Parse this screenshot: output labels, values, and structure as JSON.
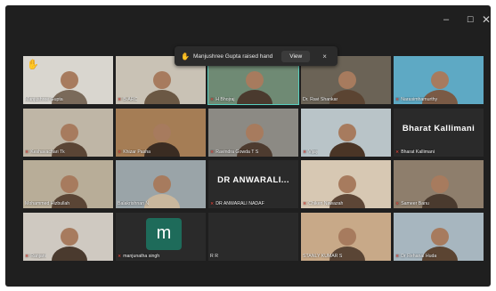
{
  "window": {
    "controls": {
      "minimize": "–",
      "maximize": "☐",
      "close": "✕"
    }
  },
  "notification": {
    "icon": "raised-hand-icon",
    "text": "Manjushree Gupta raised hand",
    "view_label": "View",
    "close_symbol": "×"
  },
  "tiles": [
    {
      "name": "Manjushree Gupta",
      "muted": false,
      "hand_raised": true
    },
    {
      "name": "B-ARC",
      "muted": true
    },
    {
      "name": "H Bhojraj",
      "muted": true,
      "active": true
    },
    {
      "name": "Dr. Ravi Shankar",
      "muted": false
    },
    {
      "name": "Narasimhamurthy",
      "muted": true
    },
    {
      "name": "Keshavachari Tk",
      "muted": true
    },
    {
      "name": "Khizar Pasha",
      "muted": true
    },
    {
      "name": "Ravindra Gowda T S",
      "muted": true
    },
    {
      "name": "Vijay",
      "muted": true
    },
    {
      "name": "Bharat Kallimani",
      "muted": true,
      "big_label": "Bharat Kallimani"
    },
    {
      "name": "Mohammed Hizbullah",
      "muted": false
    },
    {
      "name": "Balakrishnan N",
      "muted": false
    },
    {
      "name": "DR ANWARALI NADAF",
      "muted": true,
      "big_label": "DR ANWARALI..."
    },
    {
      "name": "Chiken Nawazah",
      "muted": true
    },
    {
      "name": "Sameer Banu",
      "muted": true
    },
    {
      "name": "Ranjani",
      "muted": true
    },
    {
      "name": "manjunatha singh",
      "muted": true,
      "avatar_letter": "m"
    },
    {
      "name": "R R",
      "muted": false
    },
    {
      "name": "STANLY KUMAR S",
      "muted": false
    },
    {
      "name": "Dr Rehanal Huda",
      "muted": true
    }
  ],
  "colors": {
    "window_bg": "#1f1f1f",
    "tile_bg": "#2a2a2a",
    "active_border": "#58d0c0",
    "muted_icon": "#e0483e",
    "hand": "#f6c34a",
    "avatar_bg": "#1e6b5a"
  }
}
